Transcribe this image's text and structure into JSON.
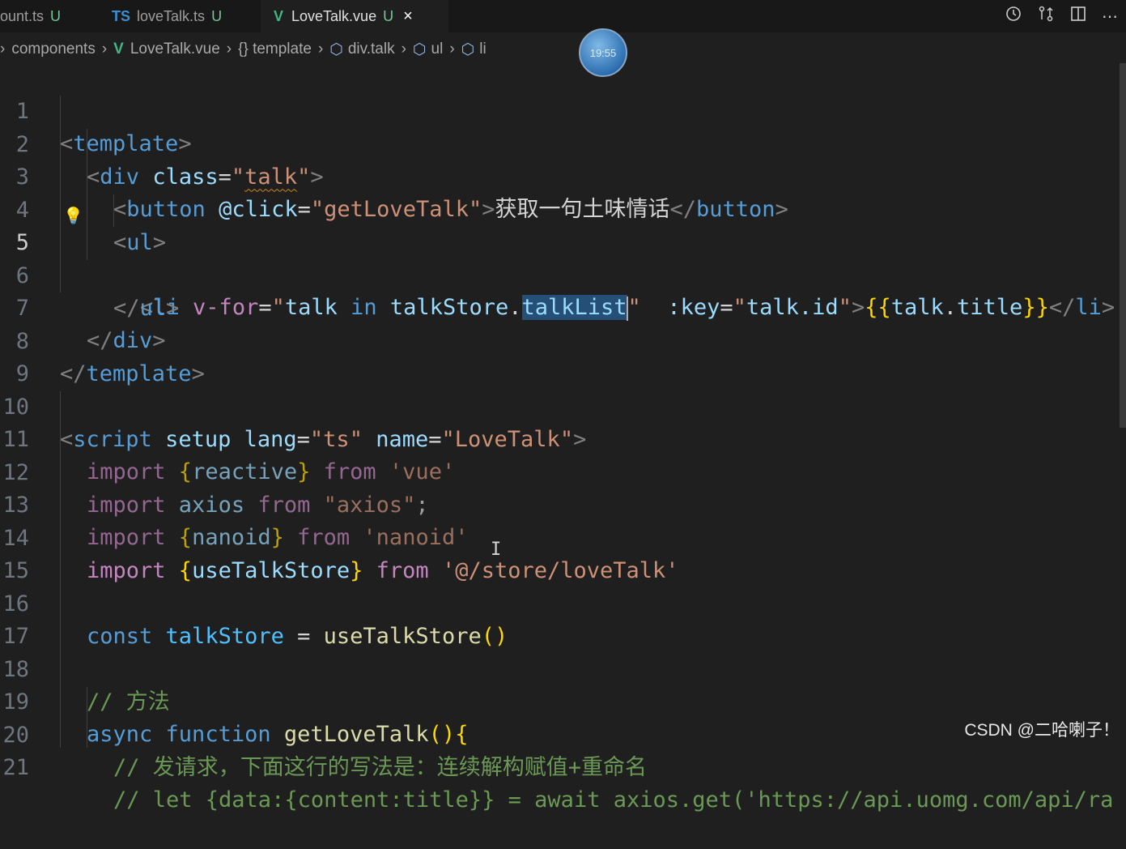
{
  "tabs": [
    {
      "label": "ount.ts",
      "status": "U"
    },
    {
      "icon": "TS",
      "label": "loveTalk.ts",
      "status": "U"
    },
    {
      "icon": "V",
      "label": "LoveTalk.vue",
      "status": "U",
      "close": "×"
    }
  ],
  "breadcrumbs": [
    "components",
    "LoveTalk.vue",
    "{} template",
    "div.talk",
    "ul",
    "li"
  ],
  "clock": "19:55",
  "lines": [
    "1",
    "2",
    "3",
    "4",
    "5",
    "6",
    "7",
    "8",
    "9",
    "10",
    "11",
    "12",
    "13",
    "14",
    "15",
    "16",
    "17",
    "18",
    "19",
    "20",
    "21"
  ],
  "code": {
    "l1": {
      "a": "<",
      "b": "template",
      "c": ">"
    },
    "l2": {
      "a": "<",
      "b": "div",
      "c": " ",
      "d": "class",
      "e": "=",
      "f": "\"",
      "g": "talk",
      "h": "\"",
      "i": ">"
    },
    "l3": {
      "a": "<",
      "b": "button",
      "c": " ",
      "d": "@click",
      "e": "=",
      "f": "\"",
      "g": "getLoveTalk",
      "h": "\"",
      "i": ">",
      "j": "获取一句土味情话",
      "k": "</",
      "l": "button",
      "m": ">"
    },
    "l4": {
      "a": "<",
      "b": "ul",
      "c": ">"
    },
    "l5": {
      "a": "<",
      "b": "li",
      "c": " ",
      "d": "v-for",
      "e": "=",
      "f": "\"",
      "g": "talk",
      "h": " in ",
      "i": "talkStore",
      "j": ".",
      "k": "talkList",
      "l": "\"",
      "m": "  ",
      "n": ":key",
      "o": "=",
      "p": "\"",
      "q": "talk.id",
      "r": "\"",
      "s": ">",
      "t": "{{",
      "u": "talk",
      "v": ".",
      "w": "title",
      "x": "}}",
      "y": "</",
      "z": "li",
      "z2": ">"
    },
    "l6": {
      "a": "</",
      "b": "ul",
      "c": ">"
    },
    "l7": {
      "a": "</",
      "b": "div",
      "c": ">"
    },
    "l8": {
      "a": "</",
      "b": "template",
      "c": ">"
    },
    "l10": {
      "a": "<",
      "b": "script",
      "c": " ",
      "d": "setup",
      "e": " ",
      "f": "lang",
      "g": "=",
      "h": "\"ts\"",
      "i": " ",
      "j": "name",
      "k": "=",
      "l": "\"LoveTalk\"",
      "m": ">"
    },
    "l11": {
      "a": "import ",
      "b": "{",
      "c": "reactive",
      "d": "}",
      "e": " from ",
      "f": "'vue'"
    },
    "l12": {
      "a": "import ",
      "b": "axios",
      "c": " from ",
      "d": "\"axios\"",
      "e": ";"
    },
    "l13": {
      "a": "import ",
      "b": "{",
      "c": "nanoid",
      "d": "}",
      "e": " from ",
      "f": "'nanoid'"
    },
    "l14": {
      "a": "import ",
      "b": "{",
      "c": "useTalkStore",
      "d": "}",
      "e": " from ",
      "f": "'@/store/loveTalk'"
    },
    "l16": {
      "a": "const ",
      "b": "talkStore",
      "c": " = ",
      "d": "useTalkStore",
      "e": "()"
    },
    "l18": {
      "a": "// 方法"
    },
    "l19": {
      "a": "async ",
      "b": "function ",
      "c": "getLoveTalk",
      "d": "()",
      "e": "{"
    },
    "l20": {
      "a": "// 发请求，下面这行的写法是：连续解构赋值+重命名"
    },
    "l21": {
      "a": "// let {data:{content:title}} = await axios.get('https://api.uomg.com/api/ra"
    }
  },
  "watermark": "CSDN @二哈喇子！"
}
